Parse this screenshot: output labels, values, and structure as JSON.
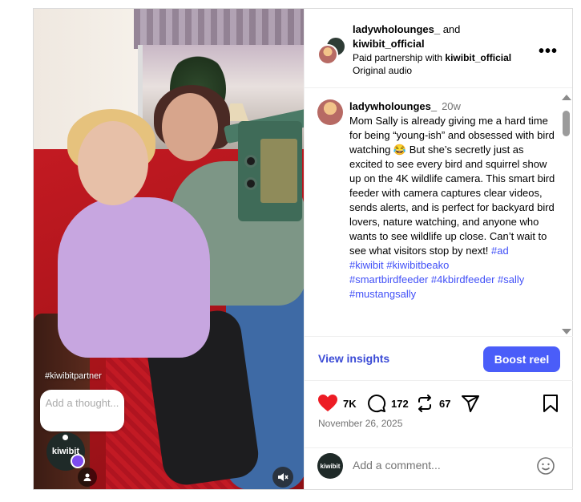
{
  "media": {
    "partner_tag": "#kiwibitpartner",
    "thought_placeholder": "Add a thought...",
    "brand_label": "kiwibit"
  },
  "header": {
    "user1": "ladywholounges_",
    "and_text": " and",
    "user2": "kiwibit_official",
    "paid_prefix": "Paid partnership with ",
    "paid_brand": "kiwibit_official",
    "audio": "Original audio"
  },
  "caption": {
    "username": "ladywholounges_",
    "time": "20w",
    "text": "Mom Sally is already giving me a hard time for being “young-ish” and obsessed with bird watching 😂 But she’s secretly just as excited to see every bird and squirrel show up on the 4K wildlife camera. This smart bird feeder with camera captures clear videos, sends alerts, and is perfect for backyard bird lovers, nature watching, and anyone who wants to see wildlife up close. Can’t wait to see what visitors stop by next! ",
    "hashtags": [
      "#ad",
      "#kiwibit",
      "#kiwibitbeako",
      "#smartbirdfeeder",
      "#4kbirdfeeder",
      "#sally",
      "#mustangsally"
    ]
  },
  "insights": {
    "view_label": "View insights",
    "boost_label": "Boost reel"
  },
  "actions": {
    "likes": "7K",
    "comments": "172",
    "reposts": "67"
  },
  "date": "November 26, 2025",
  "comment": {
    "placeholder": "Add a comment...",
    "avatar_label": "kiwibit"
  },
  "colors": {
    "accent": "#4a5df9",
    "like": "#ed1c24",
    "hashtag": "#4150f7"
  }
}
